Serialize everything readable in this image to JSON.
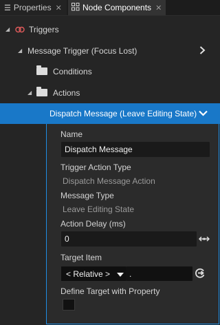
{
  "tabs": [
    {
      "icon": "list-icon",
      "label": "Properties",
      "close": "✕"
    },
    {
      "icon": "node-components-icon",
      "label": "Node Components",
      "close": "✕"
    }
  ],
  "tree": {
    "triggers": "Triggers",
    "message_trigger": "Message Trigger (Focus Lost)",
    "conditions": "Conditions",
    "actions": "Actions",
    "dispatch_message": "Dispatch Message (Leave Editing State)"
  },
  "properties": {
    "name_label": "Name",
    "name_value": "Dispatch Message",
    "trigger_action_type_label": "Trigger Action Type",
    "trigger_action_type_value": "Dispatch Message Action",
    "message_type_label": "Message Type",
    "message_type_value": "Leave Editing State",
    "action_delay_label": "Action Delay (ms)",
    "action_delay_value": "0",
    "target_item_label": "Target Item",
    "target_item_mode": "< Relative >",
    "target_item_path": ".",
    "define_target_label": "Define Target with Property",
    "define_target_checked": false
  },
  "colors": {
    "selection": "#1978c8",
    "panel_border": "#1e8fe6",
    "trigger_icon": "#e05b5b"
  }
}
